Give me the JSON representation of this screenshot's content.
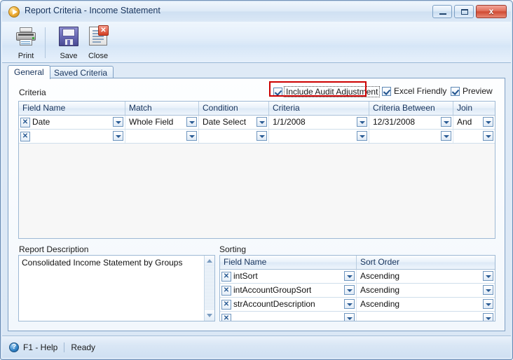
{
  "window": {
    "title": "Report Criteria - Income Statement",
    "title_icon": "play-circle-icon",
    "controls": {
      "minimize": "minimize-icon",
      "maximize": "maximize-icon",
      "close": "x"
    }
  },
  "toolbar": {
    "items": [
      {
        "label": "Print",
        "icon": "printer-icon"
      },
      {
        "label": "Save",
        "icon": "floppy-disk-icon"
      },
      {
        "label": "Close",
        "icon": "document-close-icon"
      }
    ]
  },
  "tabs": [
    {
      "label": "General",
      "active": true
    },
    {
      "label": "Saved Criteria",
      "active": false
    }
  ],
  "criteria_section": {
    "label": "Criteria",
    "options": [
      {
        "label": "Include Audit Adjustment",
        "checked": true,
        "focused": true,
        "highlighted": true
      },
      {
        "label": "Excel Friendly",
        "checked": true,
        "focused": false,
        "highlighted": false
      },
      {
        "label": "Preview",
        "checked": true,
        "focused": false,
        "highlighted": false
      }
    ],
    "columns": [
      "Field Name",
      "Match",
      "Condition",
      "Criteria",
      "Criteria Between",
      "Join"
    ],
    "rows": [
      {
        "field_name": "Date",
        "match": "Whole Field",
        "condition": "Date Select",
        "criteria": "1/1/2008",
        "criteria_between": "12/31/2008",
        "join": "And"
      },
      {
        "field_name": "",
        "match": "",
        "condition": "",
        "criteria": "",
        "criteria_between": "",
        "join": ""
      }
    ]
  },
  "report_description": {
    "label": "Report Description",
    "value": "Consolidated Income Statement by Groups"
  },
  "sorting_section": {
    "label": "Sorting",
    "columns": [
      "Field Name",
      "Sort Order"
    ],
    "rows": [
      {
        "field_name": "intSort",
        "sort_order": "Ascending"
      },
      {
        "field_name": "intAccountGroupSort",
        "sort_order": "Ascending"
      },
      {
        "field_name": "strAccountDescription",
        "sort_order": "Ascending"
      },
      {
        "field_name": "",
        "sort_order": ""
      }
    ]
  },
  "statusbar": {
    "help_icon": "question-mark-icon",
    "help_text": "F1 - Help",
    "status_text": "Ready"
  },
  "colors": {
    "accent": "#2a5b93",
    "highlight_box": "#cc0000",
    "titlebar": "#cfe0f2",
    "close_button": "#cf4a33"
  }
}
